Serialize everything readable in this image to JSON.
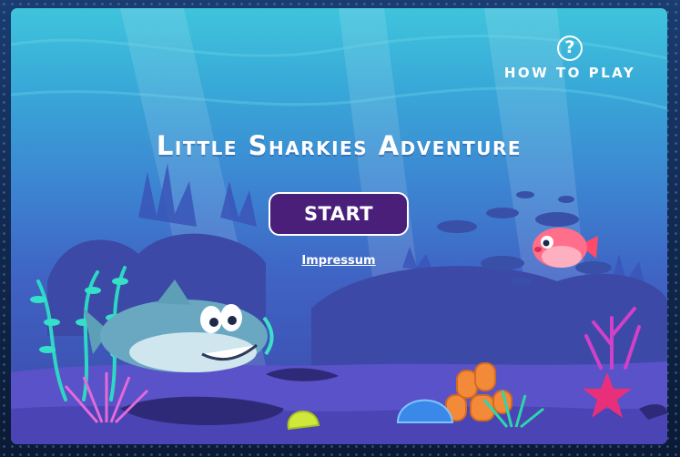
{
  "game": {
    "title": "Little Sharkies Adventure",
    "start_label": "START",
    "impressum_label": "Impressum"
  },
  "help": {
    "icon_glyph": "?",
    "label": "HOW TO PLAY"
  },
  "colors": {
    "start_button": "#4a1f7a",
    "water_top": "#3fc4dc",
    "water_bottom": "#3d47a8",
    "sand": "#5a52c8"
  }
}
